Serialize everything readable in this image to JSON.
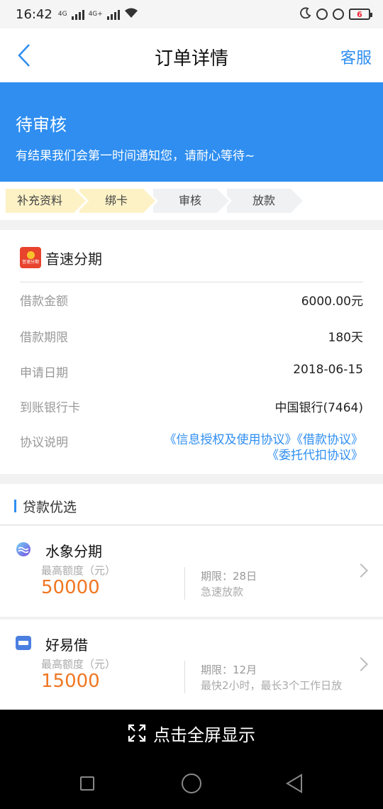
{
  "status_bar": {
    "time": "16:42",
    "net1": "4G",
    "net2": "4G+",
    "battery": "6"
  },
  "header": {
    "title": "订单详情",
    "service_label": "客服"
  },
  "banner": {
    "title": "待审核",
    "subtitle": "有结果我们会第一时间通知您，请耐心等待~",
    "color": "#2f8ef0"
  },
  "steps": [
    {
      "label": "补充资料",
      "state": "done"
    },
    {
      "label": "绑卡",
      "state": "done"
    },
    {
      "label": "审核",
      "state": "pending"
    },
    {
      "label": "放款",
      "state": "pending"
    }
  ],
  "order": {
    "brand_name": "音速分期",
    "brand_logo_text": "音速分期",
    "rows": [
      {
        "label": "借款金额",
        "value": "6000.00元"
      },
      {
        "label": "借款期限",
        "value": "180天"
      },
      {
        "label": "申请日期",
        "value": "2018-06-15"
      },
      {
        "label": "到账银行卡",
        "value": "中国银行(7464)"
      }
    ],
    "agreement_label": "协议说明",
    "agreement_line1": "《信息授权及使用协议》《借款协议》",
    "agreement_line2": "《委托代扣协议》"
  },
  "recommend": {
    "title": "贷款优选",
    "items": [
      {
        "name": "水象分期",
        "max_label": "最高额度（元）",
        "amount": "50000",
        "term": "期限：28日",
        "feature": "急速放款",
        "icon": "water-elephant-logo-icon"
      },
      {
        "name": "好易借",
        "max_label": "最高额度（元）",
        "amount": "15000",
        "term": "期限：12月",
        "feature": "最快2小时，最长3个工作日放",
        "icon": "haoyijie-logo-icon"
      }
    ]
  },
  "fullscreen": {
    "label": "点击全屏显示"
  },
  "colors": {
    "accent": "#2f8ef0",
    "amount": "#f07722",
    "step_done": "#fdf2c6",
    "step_pending": "#f0f1f3"
  }
}
